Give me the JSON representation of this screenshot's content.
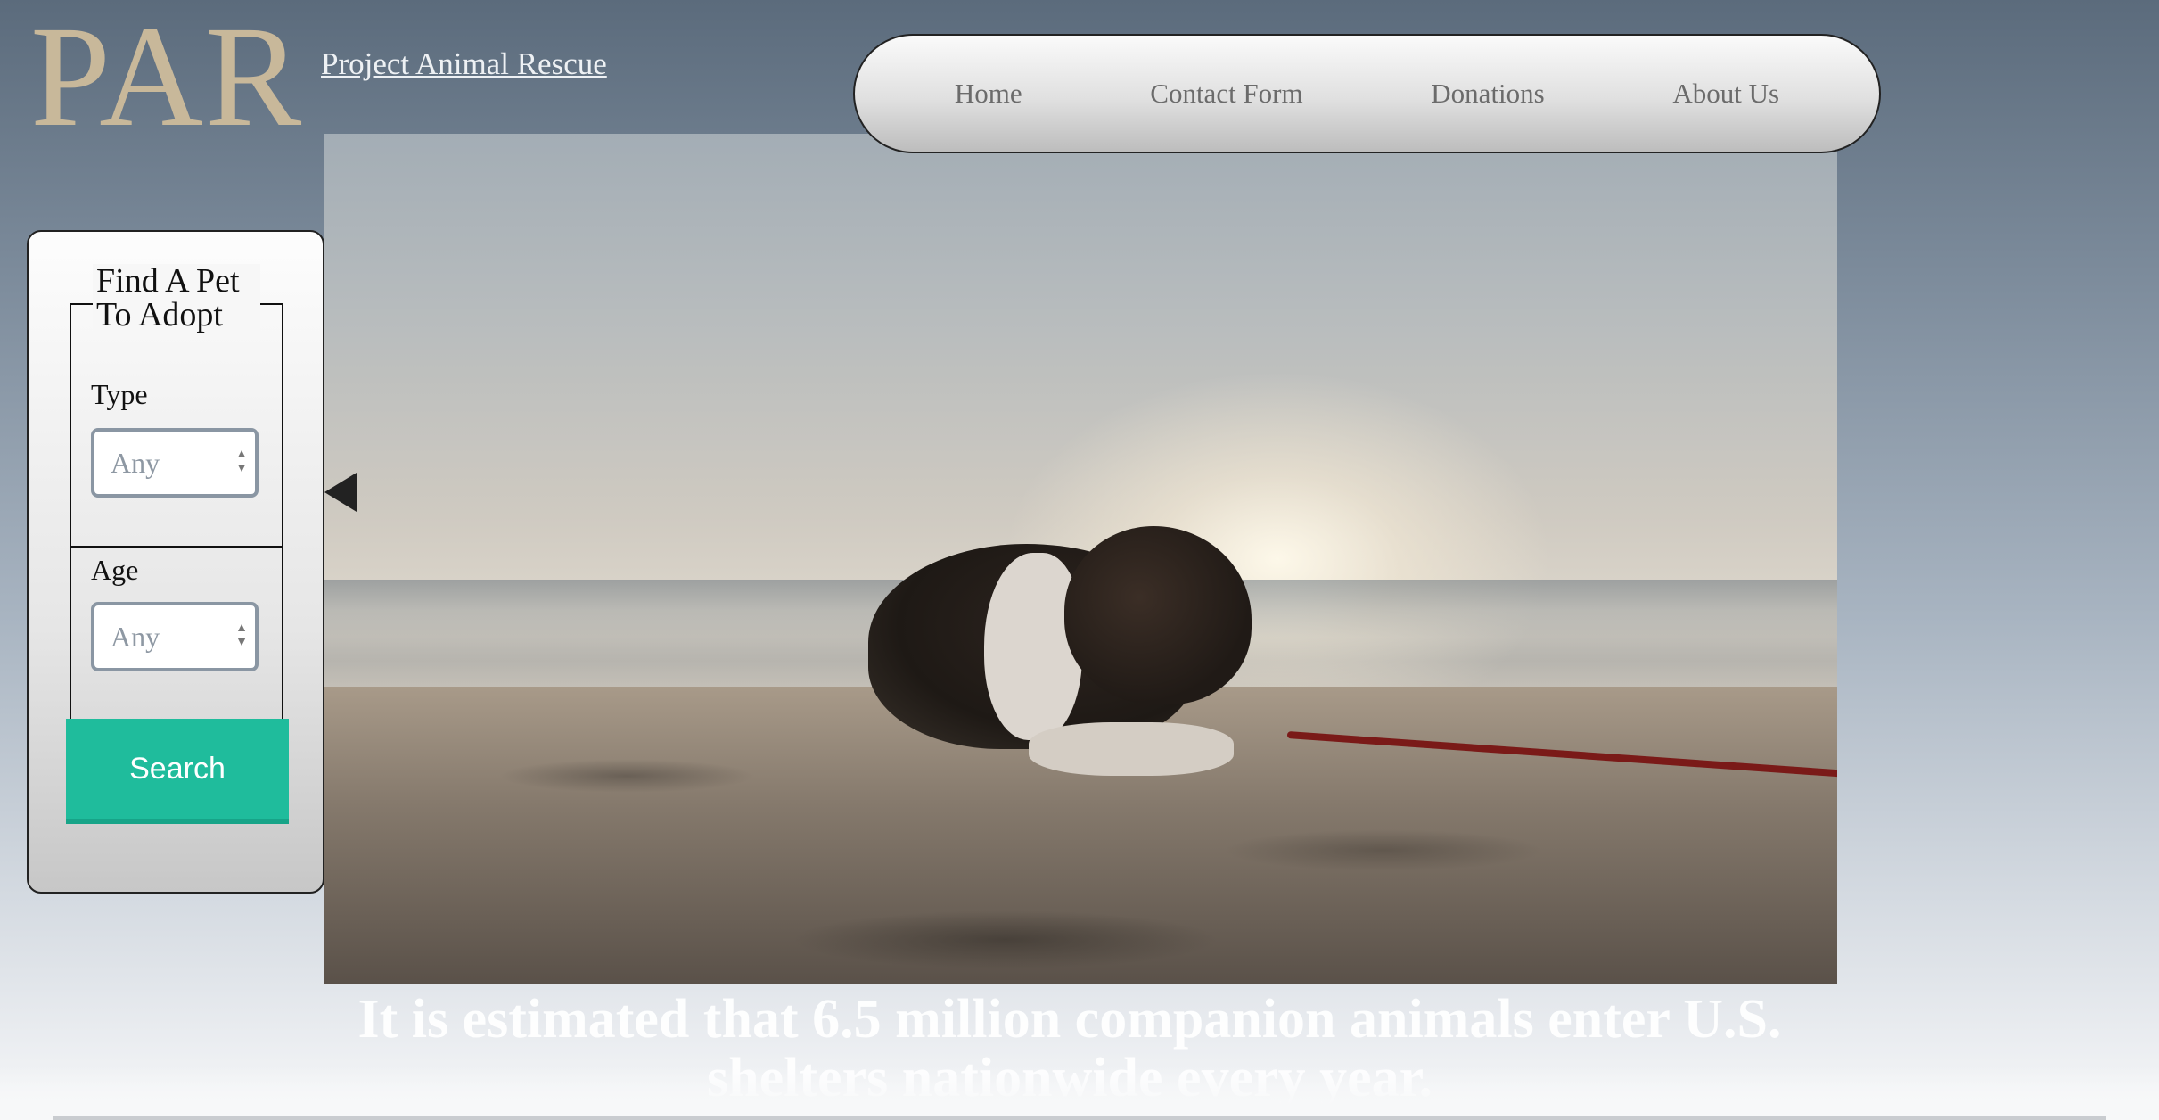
{
  "brand": {
    "logo": "PAR",
    "name": "Project Animal Rescue"
  },
  "nav": {
    "items": [
      "Home",
      "Contact Form",
      "Donations",
      "About Us"
    ]
  },
  "finder": {
    "title": "Find A Pet To Adopt",
    "type_label": "Type",
    "type_value": "Any",
    "age_label": "Age",
    "age_value": "Any",
    "search_label": "Search"
  },
  "hero": {
    "image": "puppy lying on beach sand at sunset"
  },
  "stat": {
    "text": "It is estimated that 6.5 million companion animals enter U.S. shelters nationwide every year."
  },
  "colors": {
    "accent": "#1fbc9c",
    "logo": "#c8b89a"
  }
}
